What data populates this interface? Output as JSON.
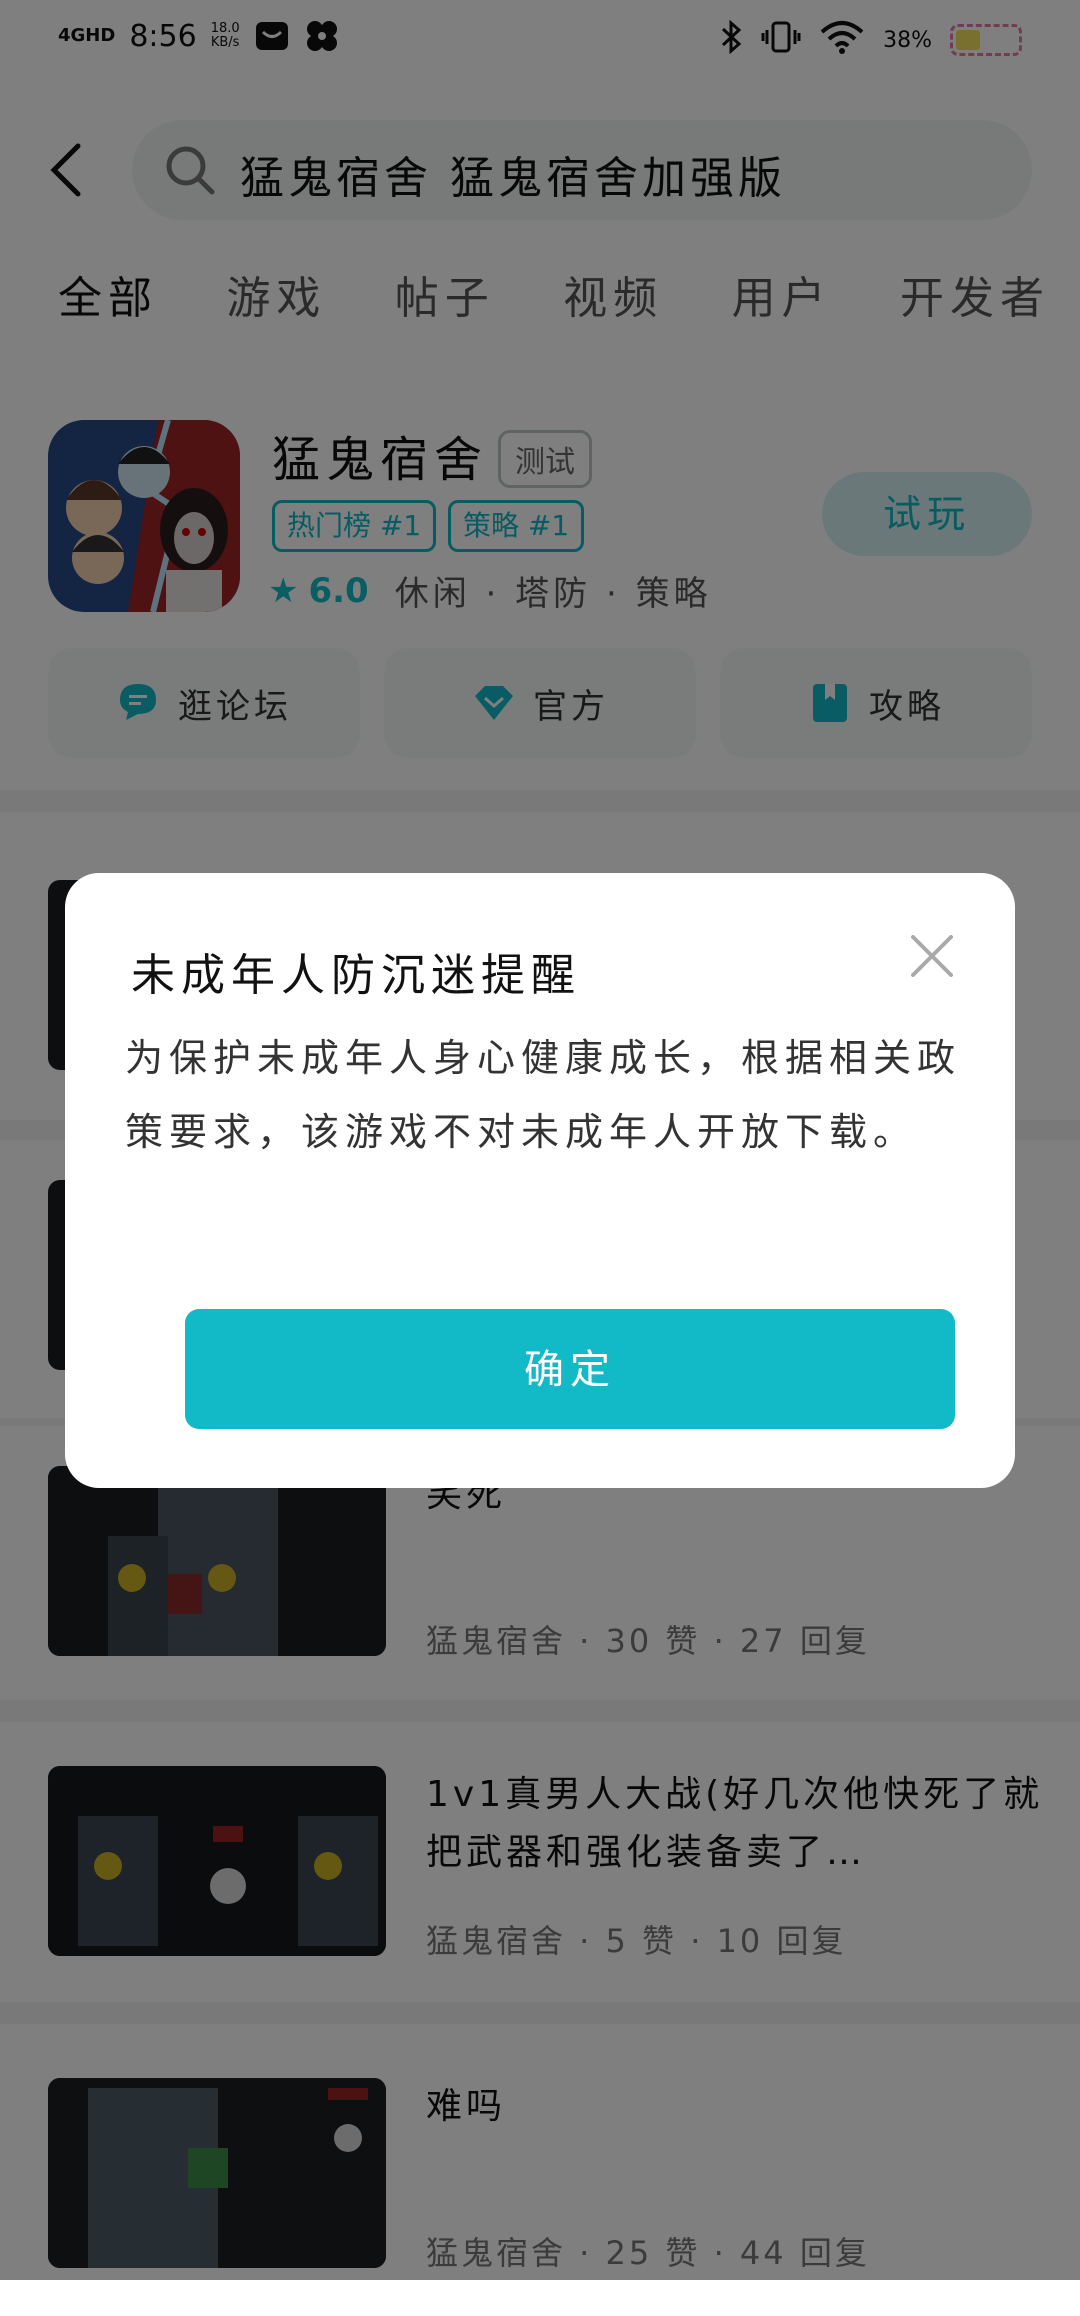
{
  "status_bar": {
    "network": "4GHD",
    "time": "8:56",
    "speed_value": "18.0",
    "speed_unit": "KB/s",
    "battery": "38%"
  },
  "search": {
    "query": "猛鬼宿舍 猛鬼宿舍加强版"
  },
  "tabs": [
    "全部",
    "游戏",
    "帖子",
    "视频",
    "用户",
    "开发者"
  ],
  "app": {
    "title": "猛鬼宿舍",
    "badge": "测试",
    "tags": [
      "热门榜 #1",
      "策略 #1"
    ],
    "rating": "6.0",
    "genres": "休闲 · 塔防 · 策略",
    "try_label": "试玩",
    "quick_links": [
      {
        "label": "逛论坛",
        "icon": "forum-icon"
      },
      {
        "label": "官方",
        "icon": "diamond-icon"
      },
      {
        "label": "攻略",
        "icon": "book-icon"
      }
    ]
  },
  "posts": [
    {
      "title": "",
      "meta": ""
    },
    {
      "title": "",
      "meta": ""
    },
    {
      "title": "笑死",
      "meta": "猛鬼宿舍 · 30 赞 · 27 回复"
    },
    {
      "title": "1v1真男人大战(好几次他快死了就把武器和强化装备卖了…",
      "meta": "猛鬼宿舍 · 5 赞 · 10 回复"
    },
    {
      "title": "难吗",
      "meta": "猛鬼宿舍 · 25 赞 · 44 回复"
    }
  ],
  "dialog": {
    "title": "未成年人防沉迷提醒",
    "body": "为保护未成年人身心健康成长，根据相关政策要求，该游戏不对未成年人开放下载。",
    "confirm": "确定"
  },
  "colors": {
    "accent": "#12b9c6",
    "overlay": "rgba(0,0,0,0.5)"
  }
}
